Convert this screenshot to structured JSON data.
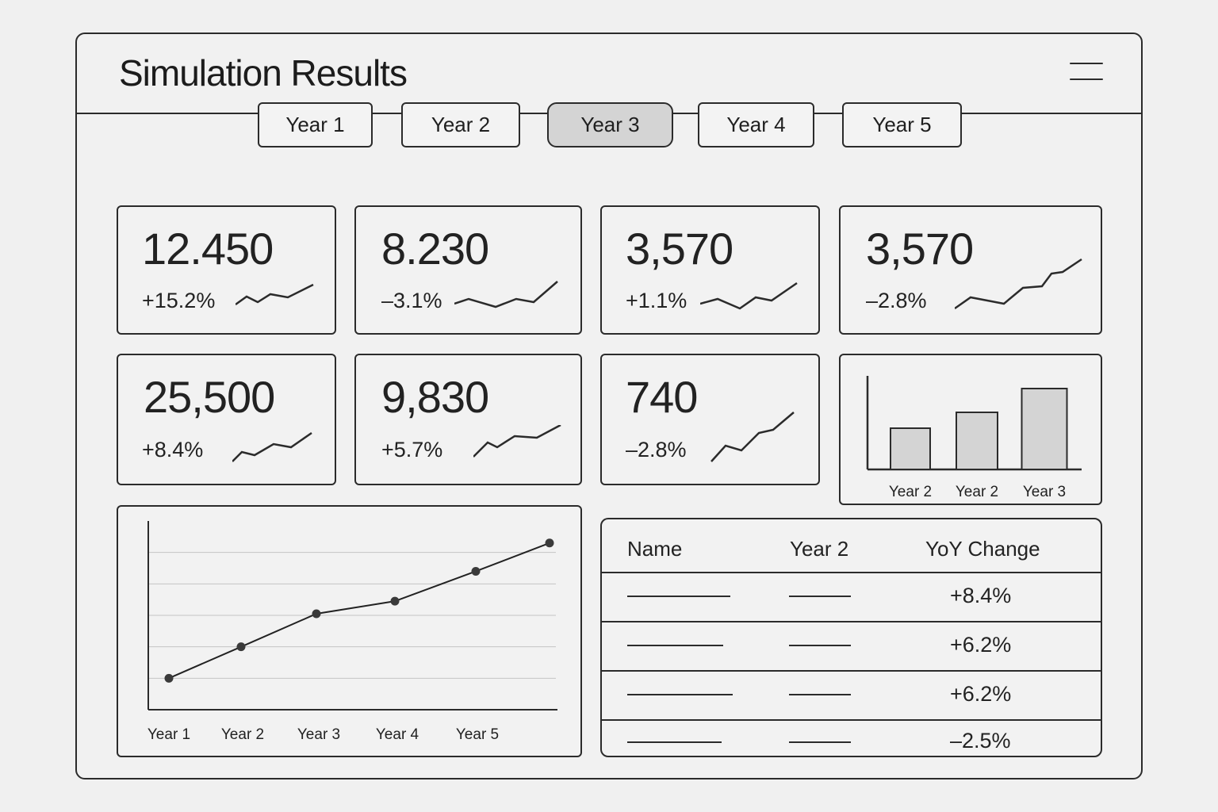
{
  "app": {
    "title": "Simulation Results",
    "menu_icon": "hamburger-menu-icon"
  },
  "tabs": [
    {
      "label": "Year 1",
      "active": false
    },
    {
      "label": "Year 2",
      "active": false
    },
    {
      "label": "Year 3",
      "active": true
    },
    {
      "label": "Year 4",
      "active": false
    },
    {
      "label": "Year 5",
      "active": false
    }
  ],
  "kpis": [
    {
      "value": "12.450",
      "change": "+15.2%"
    },
    {
      "value": "8.230",
      "change": "–3.1%"
    },
    {
      "value": "3,570",
      "change": "+1.1%"
    },
    {
      "value": "3,570",
      "change": "–2.8%"
    },
    {
      "value": "25,500",
      "change": "+8.4%"
    },
    {
      "value": "9,830",
      "change": "+5.7%"
    },
    {
      "value": "740",
      "change": "–2.8%"
    }
  ],
  "bar_chart": {
    "chart_data": {
      "type": "bar",
      "categories": [
        "Year 2",
        "Year 2",
        "Year 3"
      ],
      "values": [
        52,
        72,
        102
      ],
      "ylim": [
        0,
        118
      ],
      "grid": false
    }
  },
  "line_chart": {
    "chart_data": {
      "type": "line",
      "x": [
        "Year 1",
        "Year 2",
        "Year 3",
        "Year 4",
        "Year 5"
      ],
      "series": [
        {
          "values": [
            1.0,
            2.0,
            3.05,
            3.45,
            4.4,
            5.3
          ]
        }
      ],
      "ylim": [
        0,
        6
      ],
      "grid": true
    }
  },
  "table": {
    "headers": [
      "Name",
      "Year 2",
      "YoY Change"
    ],
    "rows": [
      {
        "change": "+8.4%"
      },
      {
        "change": "+6.2%"
      },
      {
        "change": "+6.2%"
      },
      {
        "change": "–2.5%"
      }
    ]
  }
}
